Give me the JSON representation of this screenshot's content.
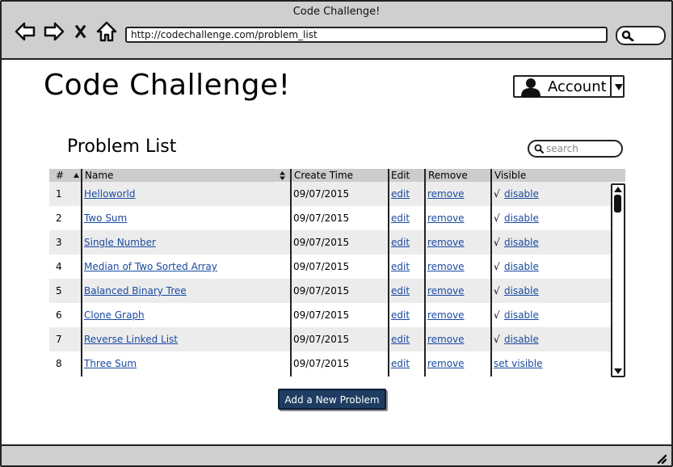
{
  "window": {
    "title": "Code Challenge!",
    "url": "http://codechallenge.com/problem_list"
  },
  "nav": {
    "back_icon": "arrow-left-icon",
    "forward_icon": "arrow-right-icon",
    "stop_icon": "close-icon",
    "home_icon": "home-icon",
    "search_icon": "search-icon"
  },
  "app": {
    "title": "Code Challenge!",
    "account_label": "Account"
  },
  "section": {
    "title": "Problem List",
    "search_placeholder": "search"
  },
  "table": {
    "headers": {
      "num": "#",
      "name": "Name",
      "create_time": "Create Time",
      "edit": "Edit",
      "remove": "Remove",
      "visible": "Visible"
    },
    "rows": [
      {
        "num": "1",
        "name": "Helloworld",
        "create_time": "09/07/2015",
        "edit": "edit",
        "remove": "remove",
        "check": "√",
        "visible": "disable"
      },
      {
        "num": "2",
        "name": "Two Sum",
        "create_time": "09/07/2015",
        "edit": "edit",
        "remove": "remove",
        "check": "√",
        "visible": "disable"
      },
      {
        "num": "3",
        "name": "Single Number",
        "create_time": "09/07/2015",
        "edit": "edit",
        "remove": "remove",
        "check": "√",
        "visible": "disable"
      },
      {
        "num": "4",
        "name": "Median of Two Sorted Array",
        "create_time": "09/07/2015",
        "edit": "edit",
        "remove": "remove",
        "check": "√",
        "visible": "disable"
      },
      {
        "num": "5",
        "name": "Balanced Binary Tree",
        "create_time": "09/07/2015",
        "edit": "edit",
        "remove": "remove",
        "check": "√",
        "visible": "disable"
      },
      {
        "num": "6",
        "name": "Clone Graph",
        "create_time": "09/07/2015",
        "edit": "edit",
        "remove": "remove",
        "check": "√",
        "visible": "disable"
      },
      {
        "num": "7",
        "name": "Reverse Linked List",
        "create_time": "09/07/2015",
        "edit": "edit",
        "remove": "remove",
        "check": "√",
        "visible": "disable"
      },
      {
        "num": "8",
        "name": "Three Sum",
        "create_time": "09/07/2015",
        "edit": "edit",
        "remove": "remove",
        "check": "",
        "visible": "set visible"
      }
    ]
  },
  "actions": {
    "add_label": "Add a New Problem"
  },
  "colors": {
    "chrome": "#cfcfcf",
    "link": "#1a4ba0",
    "button": "#1f3c62",
    "header_row": "#cccccc",
    "alt_row": "#ececec"
  }
}
